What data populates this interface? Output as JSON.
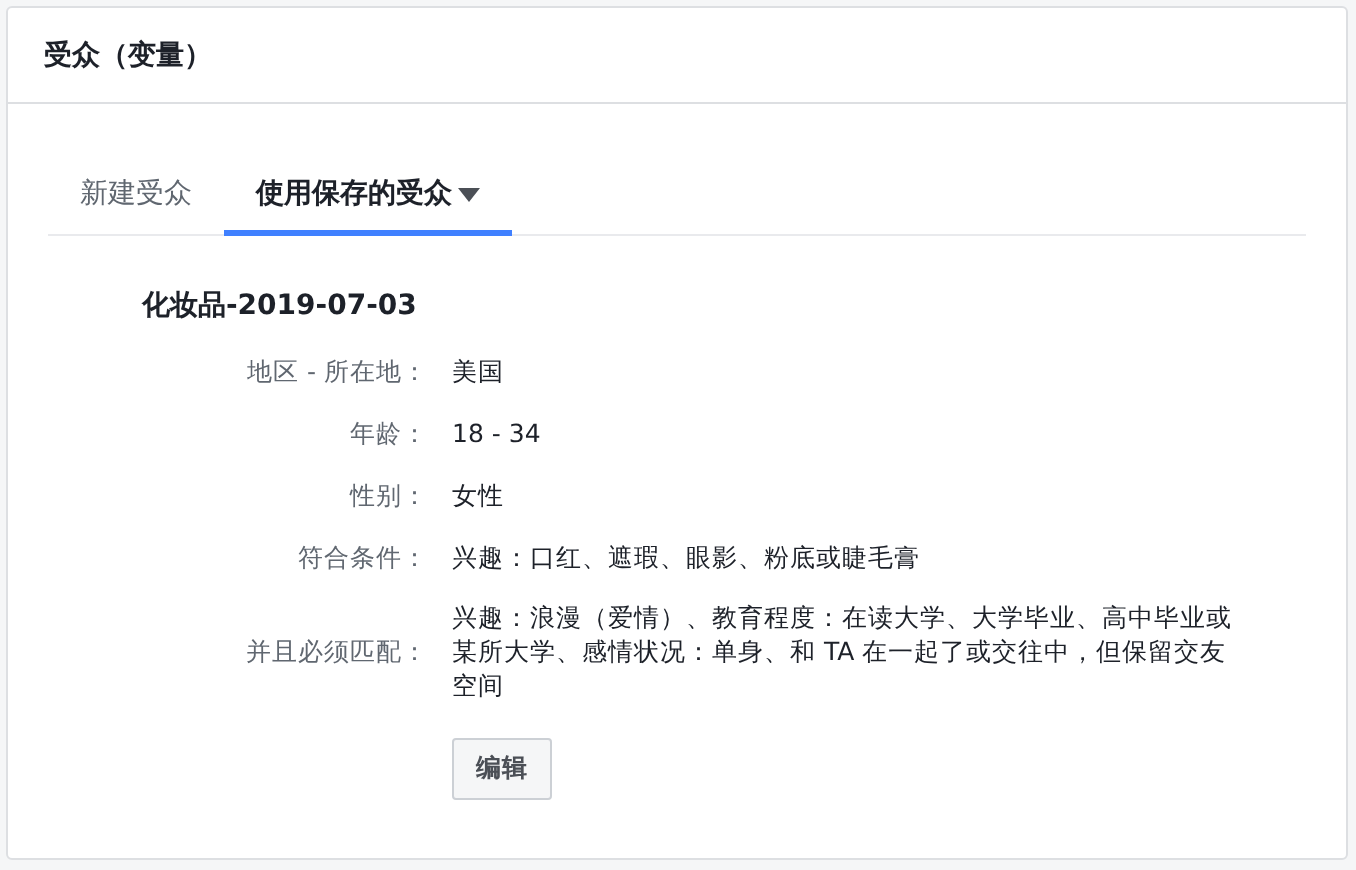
{
  "card": {
    "title": "受众（变量）"
  },
  "tabs": [
    {
      "label": "新建受众",
      "selected": false,
      "has_menu": false
    },
    {
      "label": "使用保存的受众",
      "selected": true,
      "has_menu": true
    }
  ],
  "audience": {
    "name": "化妆品-2019-07-03",
    "details": [
      {
        "label": "地区 - 所在地：",
        "value": "美国"
      },
      {
        "label": "年龄：",
        "value": "18 - 34"
      },
      {
        "label": "性别：",
        "value": "女性"
      },
      {
        "label": "符合条件：",
        "value": "兴趣：口红、遮瑕、眼影、粉底或睫毛膏"
      },
      {
        "label": "并且必须匹配：",
        "value": "兴趣：浪漫（爱情）、教育程度：在读大学、大学毕业、高中毕业或某所大学、感情状况：单身、和 TA 在一起了或交往中，但保留交友空间"
      }
    ],
    "edit_button": "编辑"
  }
}
